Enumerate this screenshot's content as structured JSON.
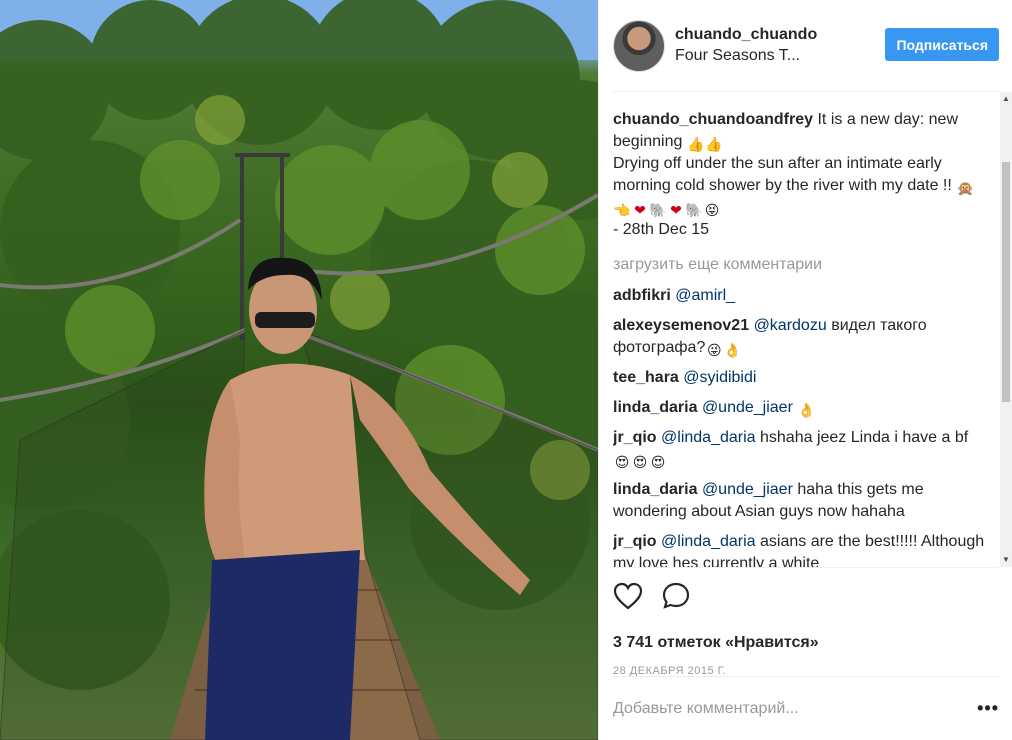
{
  "header": {
    "username": "chuando_chuando",
    "location": "Four Seasons T...",
    "follow_label": "Подписаться"
  },
  "caption": {
    "username": "chuando_chuandoandfrey",
    "line1": "It is a new day: new beginning",
    "line2": "Drying off under the sun after an intimate early morning cold shower by the river with my date !!",
    "line3": "- 28th Dec 15"
  },
  "load_more": "загрузить еще комментарии",
  "comments": [
    {
      "user": "adbfikri",
      "mention": "@amirl_",
      "text": ""
    },
    {
      "user": "alexeysemenov21",
      "mention": "@kardozu",
      "text": "видел такого фотографа?"
    },
    {
      "user": "tee_hara",
      "mention": "@syidibidi",
      "text": ""
    },
    {
      "user": "linda_daria",
      "mention": "@unde_jiaer",
      "text": ""
    },
    {
      "user": "jr_qio",
      "mention": "@linda_daria",
      "text": "hshaha jeez Linda i have a bf"
    },
    {
      "user": "linda_daria",
      "mention": "@unde_jiaer",
      "text": "haha this gets me wondering about Asian guys now hahaha"
    },
    {
      "user": "jr_qio",
      "mention": "@linda_daria",
      "text": "asians are the best!!!!! Although my love hes currently a white"
    }
  ],
  "icons": {
    "like": "heart-icon",
    "comment": "comment-icon",
    "more": "more-icon"
  },
  "likes": "3 741 отметок «Нравится»",
  "date": "28 ДЕКАБРЯ 2015 Г.",
  "add_comment_placeholder": "Добавьте комментарий...",
  "more_label": "•••",
  "colors": {
    "follow": "#3897f0",
    "mention": "#003569",
    "muted": "#999999"
  }
}
